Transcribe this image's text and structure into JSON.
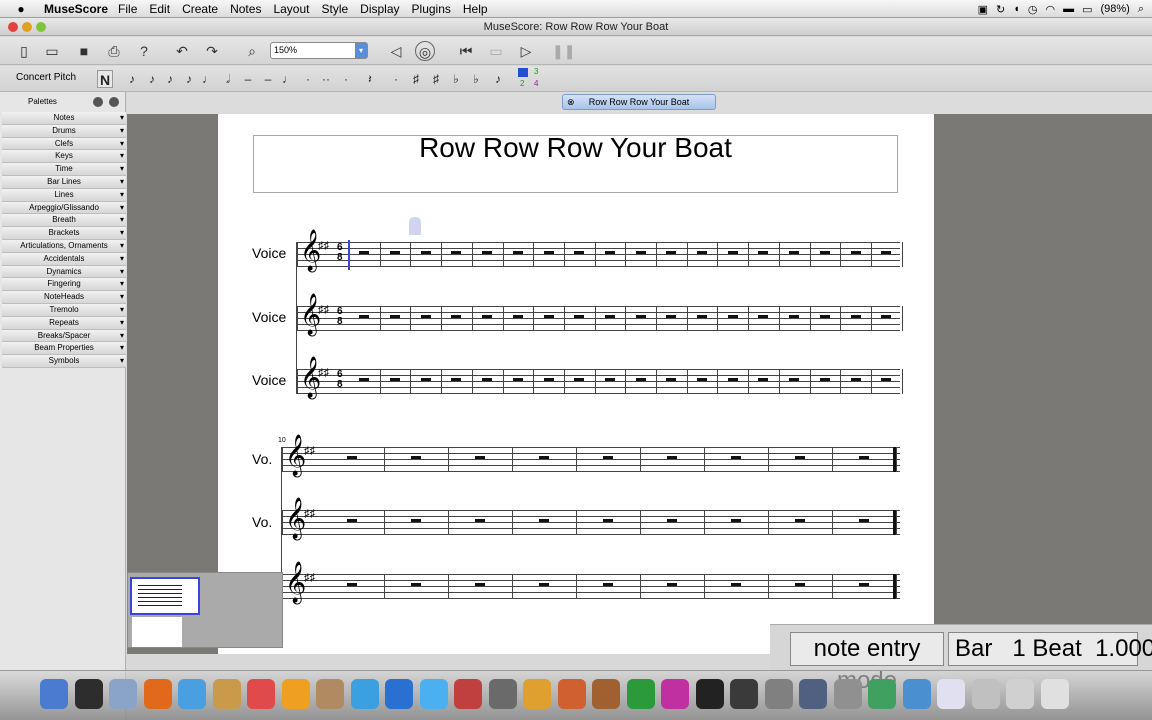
{
  "menubar": {
    "app": "MuseScore",
    "menus": [
      "File",
      "Edit",
      "Create",
      "Notes",
      "Layout",
      "Style",
      "Display",
      "Plugins",
      "Help"
    ],
    "battery": "(98%)"
  },
  "window": {
    "title": "MuseScore: Row Row Row Your Boat"
  },
  "toolbar": {
    "zoom": "150%",
    "concert_pitch": "Concert Pitch",
    "note_n": "N",
    "voice_top": [
      "3"
    ],
    "voice_bottom": [
      "2",
      "4"
    ]
  },
  "tab": {
    "label": "Row Row Row Your Boat"
  },
  "palettes": {
    "title": "Palettes",
    "items": [
      "Notes",
      "Drums",
      "Clefs",
      "Keys",
      "Time",
      "Bar Lines",
      "Lines",
      "Arpeggio/Glissando",
      "Breath",
      "Brackets",
      "Articulations, Ornaments",
      "Accidentals",
      "Dynamics",
      "Fingering",
      "NoteHeads",
      "Tremolo",
      "Repeats",
      "Breaks/Spacer",
      "Beam Properties",
      "Symbols"
    ]
  },
  "score": {
    "title": "Row Row Row Your Boat",
    "system1_labels": [
      "Voice",
      "Voice",
      "Voice"
    ],
    "system2_labels": [
      "Vo.",
      "Vo.",
      ""
    ],
    "measure_number": "10",
    "time_top": "6",
    "time_bottom": "8"
  },
  "status": {
    "mode": "note entry mode",
    "position": "Bar   1 Beat  1.000"
  },
  "colors": {
    "accent": "#3a44d8",
    "canvas": "#7a7976"
  }
}
